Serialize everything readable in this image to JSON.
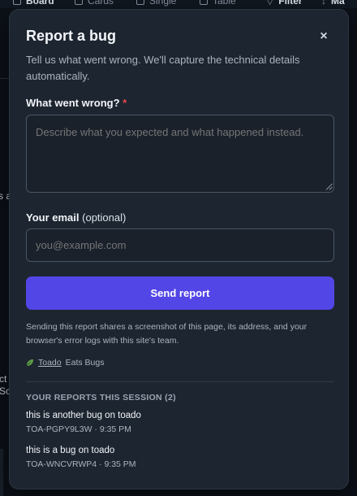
{
  "background": {
    "toolbar": [
      {
        "icon": "board-icon",
        "label": "Board"
      },
      {
        "icon": "cards-icon",
        "label": "Cards"
      },
      {
        "icon": "single-icon",
        "label": "Single"
      },
      {
        "icon": "table-icon",
        "label": "Table"
      },
      {
        "icon": "filter-icon",
        "label": "Filter"
      },
      {
        "icon": "sort-icon",
        "label": "Ma"
      }
    ],
    "side_fragments": [
      "s a",
      "ct",
      "Sc"
    ]
  },
  "modal": {
    "title": "Report a bug",
    "close_icon": "close-icon",
    "close_glyph": "×",
    "description": "Tell us what went wrong. We'll capture the technical details automatically.",
    "what_label": "What went wrong?",
    "required_mark": "*",
    "what_placeholder": "Describe what you expected and what happened instead.",
    "email_label": "Your email",
    "email_optional": "(optional)",
    "email_placeholder": "you@example.com",
    "send_label": "Send report",
    "notice": "Sending this report shares a screenshot of this page, its address, and your browser's error logs with this site's team.",
    "brand_icon": "leaf-icon",
    "brand_link": "Toado",
    "brand_suffix": "Eats Bugs",
    "reports_heading": "YOUR REPORTS THIS SESSION (2)",
    "reports": [
      {
        "title": "this is another bug on toado",
        "meta": "TOA-PGPY9L3W · 9:35 PM"
      },
      {
        "title": "this is a bug on toado",
        "meta": "TOA-WNCVRWP4 · 9:35 PM"
      }
    ]
  },
  "colors": {
    "accent": "#5346e6",
    "modal_bg": "#1d2530",
    "required": "#e5484d"
  }
}
